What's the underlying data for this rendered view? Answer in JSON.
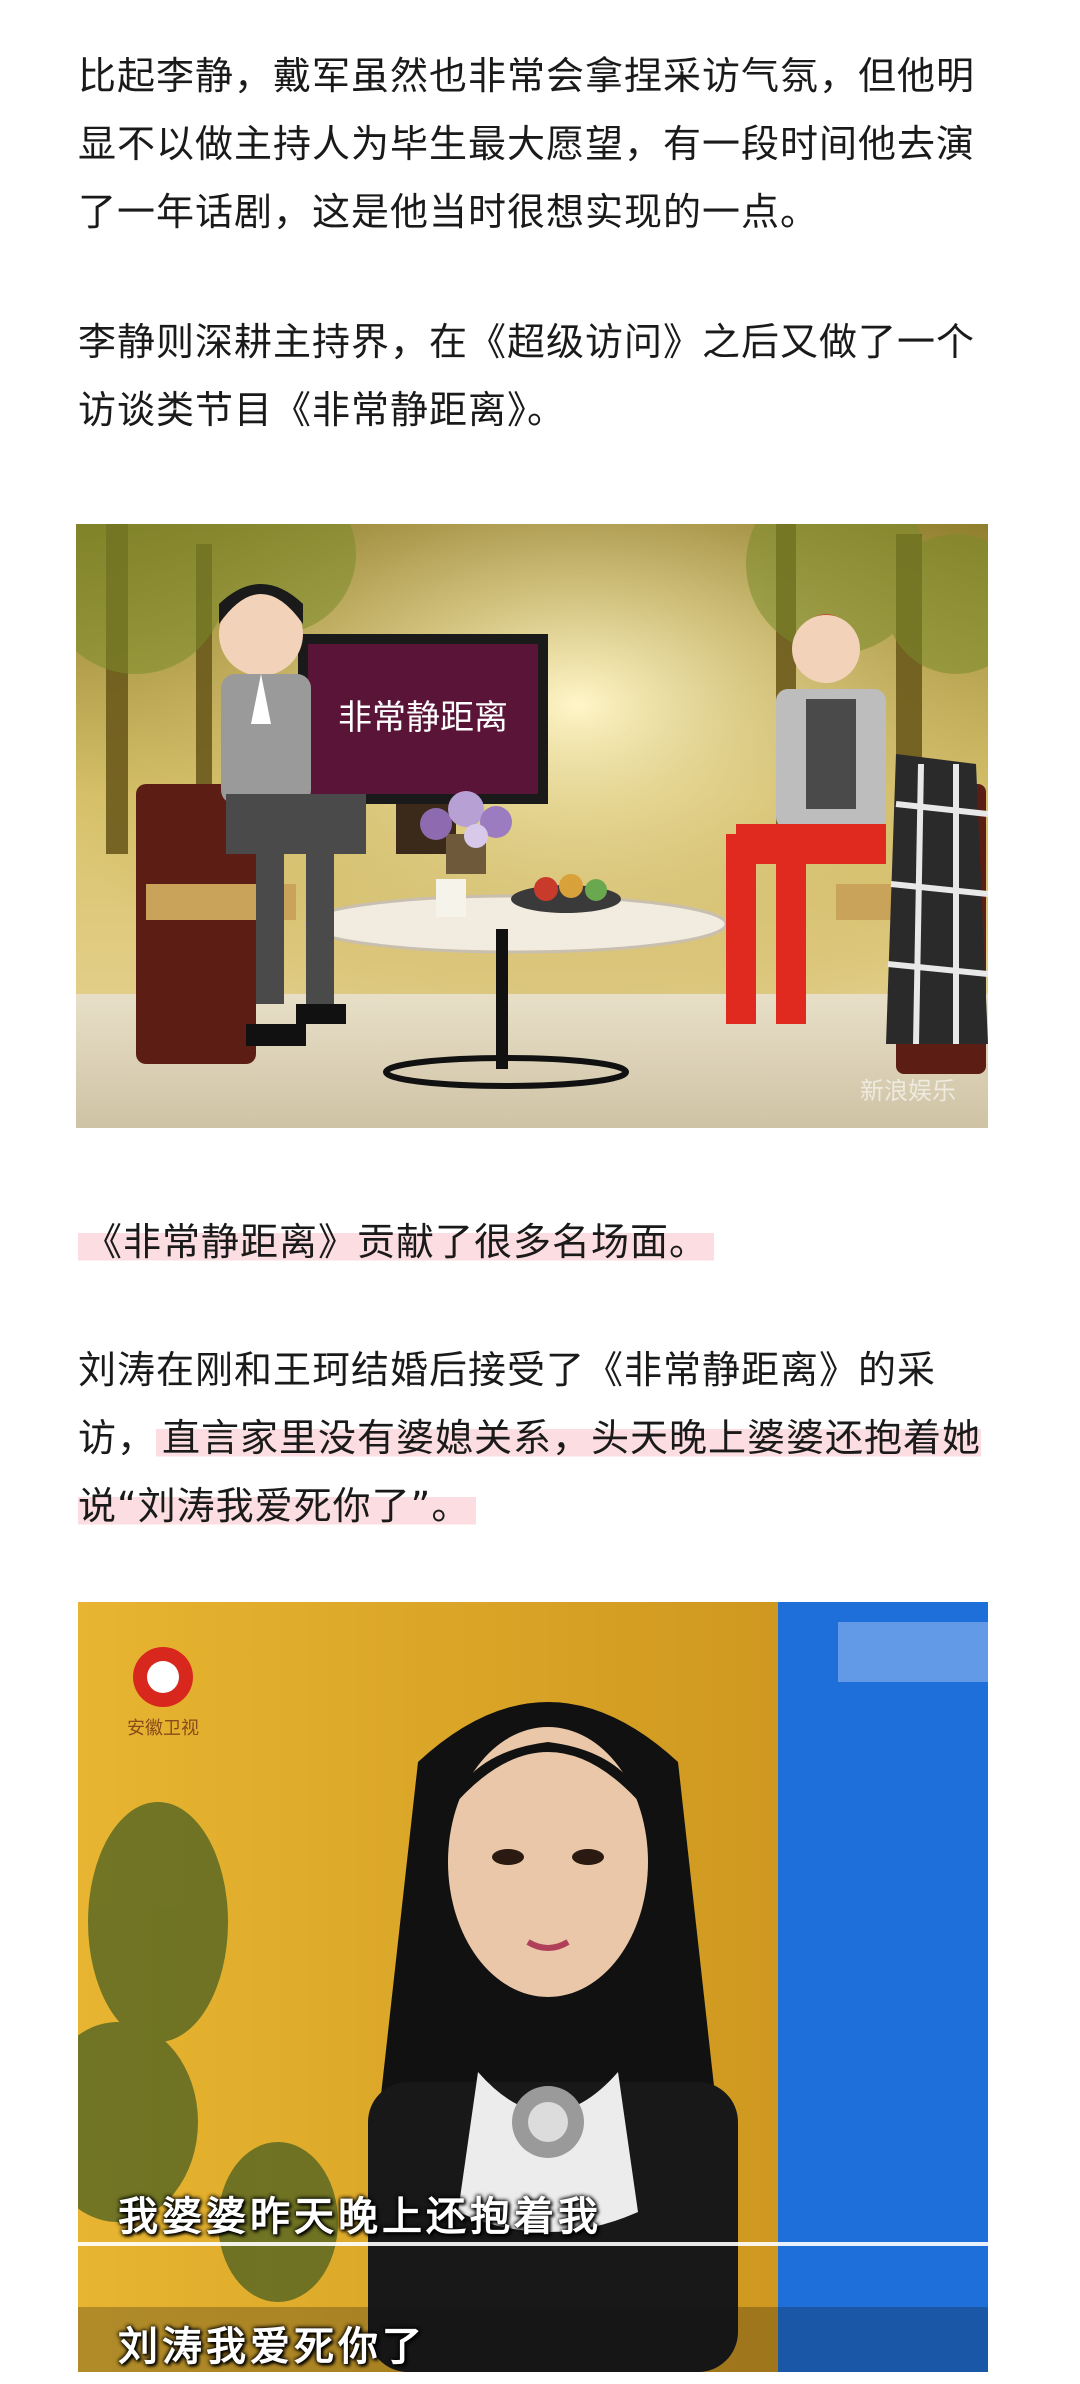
{
  "article": {
    "p1": "比起李静，戴军虽然也非常会拿捏采访气氛，但他明显不以做主持人为毕生最大愿望，有一段时间他去演了一年话剧，这是他当时很想实现的一点。",
    "p2": "李静则深耕主持界，在《超级访问》之后又做了一个访谈类节目《非常静距离》。",
    "p3": "《非常静距离》贡献了很多名场面。",
    "p4_start": "刘涛在刚和王珂结婚后接受了《非常静距离》的采访，",
    "p4_highlight": "直言家里没有婆媳关系，头天晚上婆婆还抱着她说“刘涛我爱死你了”。"
  },
  "image1": {
    "screen_logo": "非常静距离",
    "watermark": "新浪娱乐"
  },
  "image2": {
    "channel_logo": "安徽卫视",
    "subtitle1": "我婆婆昨天晚上还抱着我",
    "subtitle2": "刘涛我爱死你了"
  },
  "colors": {
    "highlight": "#fbdde2",
    "text": "#1a1a1a",
    "studio_bg": "#b9a35a",
    "blue_panel": "#1e6fd9"
  }
}
